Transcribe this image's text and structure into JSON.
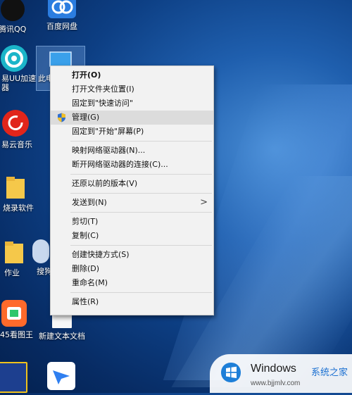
{
  "desktop": {
    "icons": [
      {
        "label": "腾讯QQ"
      },
      {
        "label": "百度网盘"
      },
      {
        "label": "易UU加速器"
      },
      {
        "label": "此电"
      },
      {
        "label": "易云音乐"
      },
      {
        "label": "烧录软件"
      },
      {
        "label": "作业"
      },
      {
        "label": "搜狗"
      },
      {
        "label": "45看图王"
      },
      {
        "label": "新建文本文档"
      }
    ]
  },
  "context_menu": {
    "items": [
      {
        "label": "打开(O)"
      },
      {
        "label": "打开文件夹位置(I)"
      },
      {
        "label": "固定到\"快速访问\""
      },
      {
        "label": "管理(G)"
      },
      {
        "label": "固定到\"开始\"屏幕(P)"
      },
      {
        "label": "映射网络驱动器(N)..."
      },
      {
        "label": "断开网络驱动器的连接(C)..."
      },
      {
        "label": "还原以前的版本(V)"
      },
      {
        "label": "发送到(N)"
      },
      {
        "label": "剪切(T)"
      },
      {
        "label": "复制(C)"
      },
      {
        "label": "创建快捷方式(S)"
      },
      {
        "label": "删除(D)"
      },
      {
        "label": "重命名(M)"
      },
      {
        "label": "属性(R)"
      }
    ],
    "submenu_arrow": ">"
  },
  "watermark": {
    "brand": "Windows",
    "cn_text": "系统之家",
    "url": "www.bjjmlv.com"
  },
  "colors": {
    "menu_bg": "#f2f2f2",
    "menu_hover": "#dcdcdc",
    "desktop_dark": "#072b63",
    "watermark_blue": "#1a6fd1"
  }
}
